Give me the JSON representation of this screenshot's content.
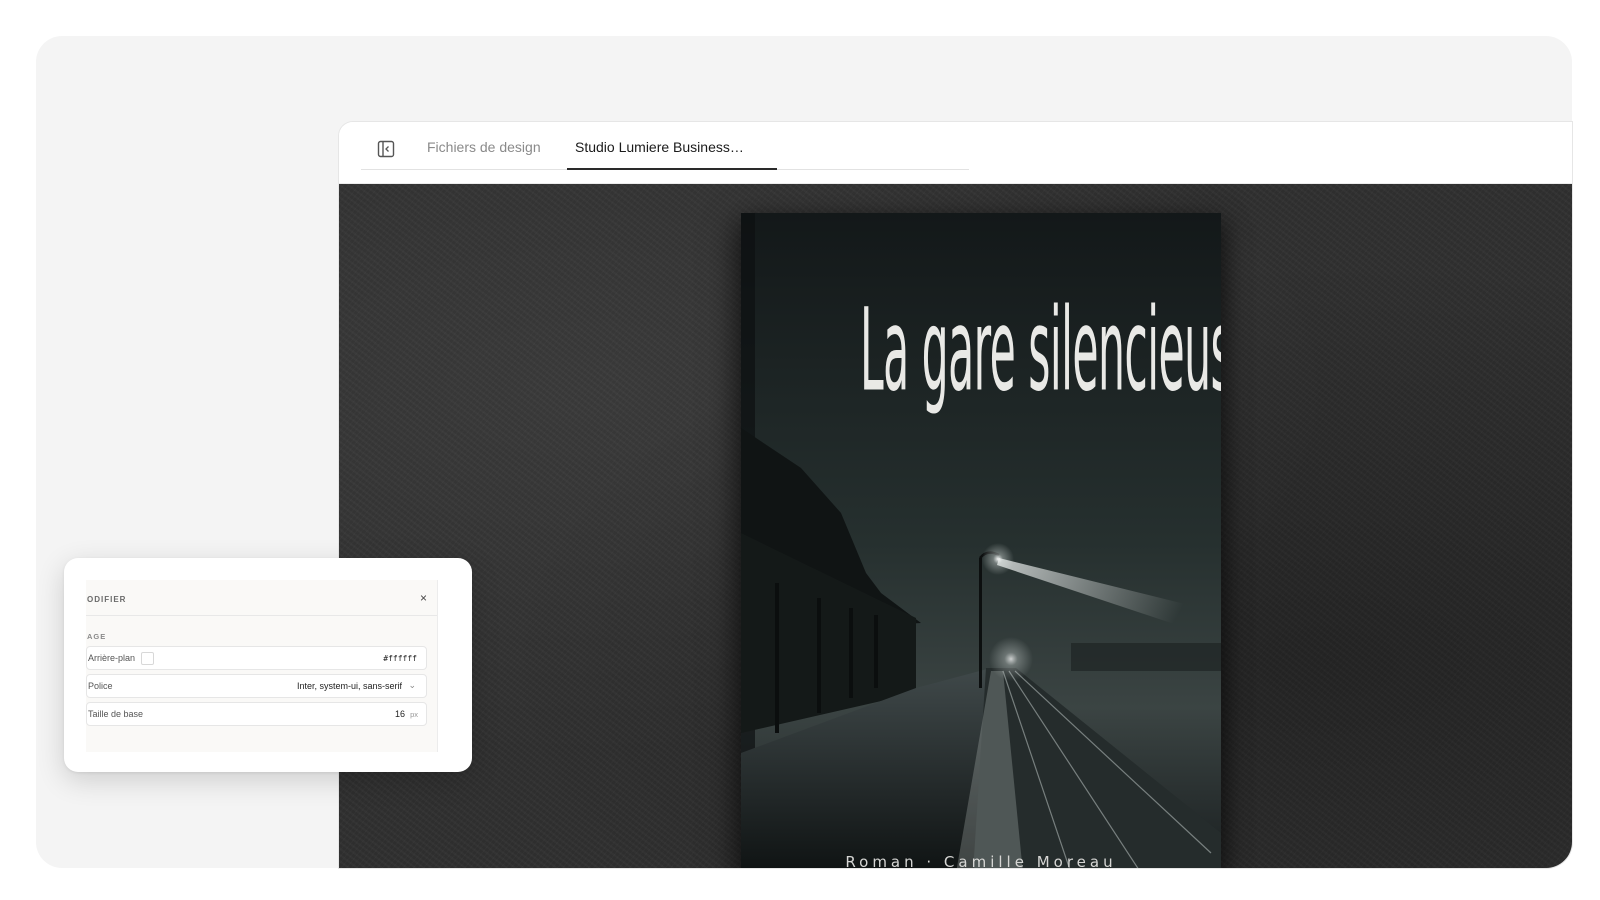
{
  "tabs": {
    "files_label": "Fichiers de design",
    "active_label": "Studio Lumiere Business…"
  },
  "book": {
    "title": "La gare silencieuse",
    "byline": "Roman · Camille Moreau"
  },
  "properties_panel": {
    "header": "ODIFIER",
    "section": "AGE",
    "close_glyph": "×",
    "rows": [
      {
        "label": "Arrière-plan",
        "value": "#ffffff"
      },
      {
        "label": "Police",
        "value": "Inter, system-ui, sans-serif"
      },
      {
        "label": "Taille de base",
        "value": "16",
        "unit": "px"
      }
    ]
  },
  "colors": {
    "outer_background": "#f4f4f4",
    "surface": "#303030",
    "cover": "#1b2022",
    "swatch": "#ffffff"
  }
}
